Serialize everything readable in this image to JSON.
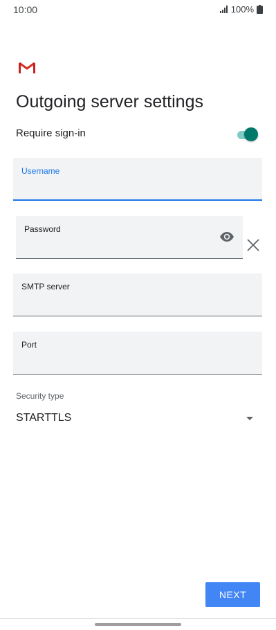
{
  "status_bar": {
    "time": "10:00",
    "battery": "100%",
    "icons": [
      "signal-icon",
      "battery-icon"
    ]
  },
  "app": {
    "logo": "gmail-logo-icon"
  },
  "page": {
    "title": "Outgoing server settings"
  },
  "require_signin": {
    "label": "Require sign-in",
    "enabled": true
  },
  "fields": {
    "username": {
      "label": "Username",
      "value": "",
      "focused": true
    },
    "password": {
      "label": "Password",
      "value": ""
    },
    "smtp_server": {
      "label": "SMTP server",
      "value": ""
    },
    "port": {
      "label": "Port",
      "value": ""
    }
  },
  "security": {
    "label": "Security type",
    "selected": "STARTTLS"
  },
  "actions": {
    "next_label": "NEXT"
  },
  "colors": {
    "accent_blue": "#1a73e8",
    "button_blue": "#4285f4",
    "toggle_teal": "#00796b",
    "gmail_red": "#d93025"
  }
}
